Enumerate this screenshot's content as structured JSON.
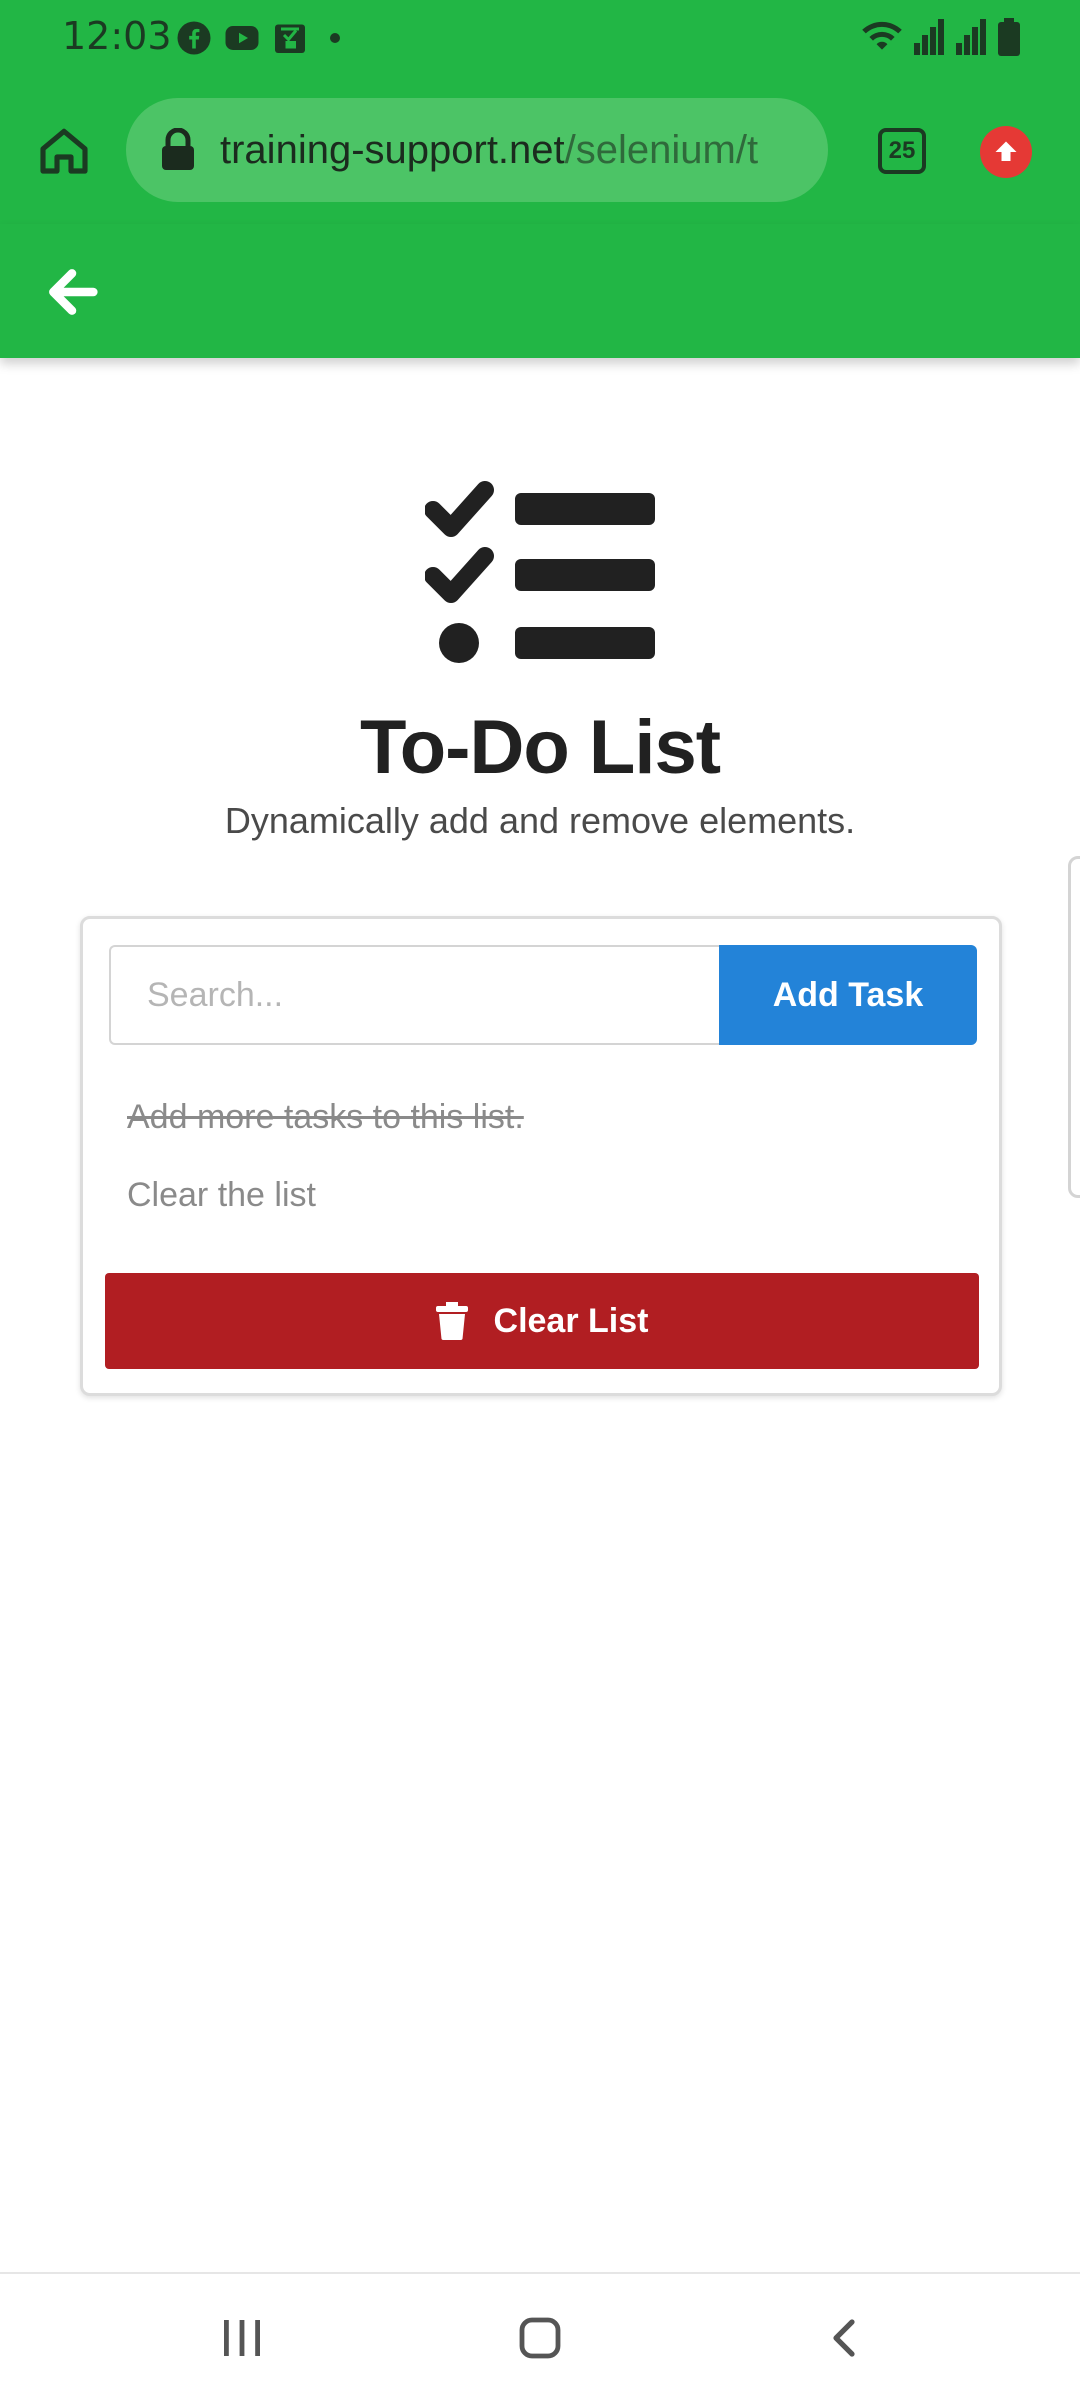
{
  "status_bar": {
    "time": "12:03",
    "left_icons": [
      "facebook-icon",
      "youtube-icon",
      "gallery-icon",
      "notification-dot"
    ],
    "right_icons": [
      "wifi-icon",
      "signal-icon",
      "signal-icon-2",
      "battery-icon"
    ]
  },
  "browser": {
    "url_domain": "training-support.net",
    "url_path": "/selenium/t",
    "tab_count": "25"
  },
  "page": {
    "title": "To-Do List",
    "subtitle": "Dynamically add and remove elements."
  },
  "todo": {
    "search_placeholder": "Search...",
    "add_button": "Add Task",
    "tasks": [
      {
        "text": "Add more tasks to this list.",
        "done": true
      },
      {
        "text": "Clear the list",
        "done": false
      }
    ],
    "clear_button": "Clear List"
  },
  "colors": {
    "header_green": "#22b645",
    "add_button_blue": "#2383d8",
    "clear_button_red": "#b11e22"
  }
}
